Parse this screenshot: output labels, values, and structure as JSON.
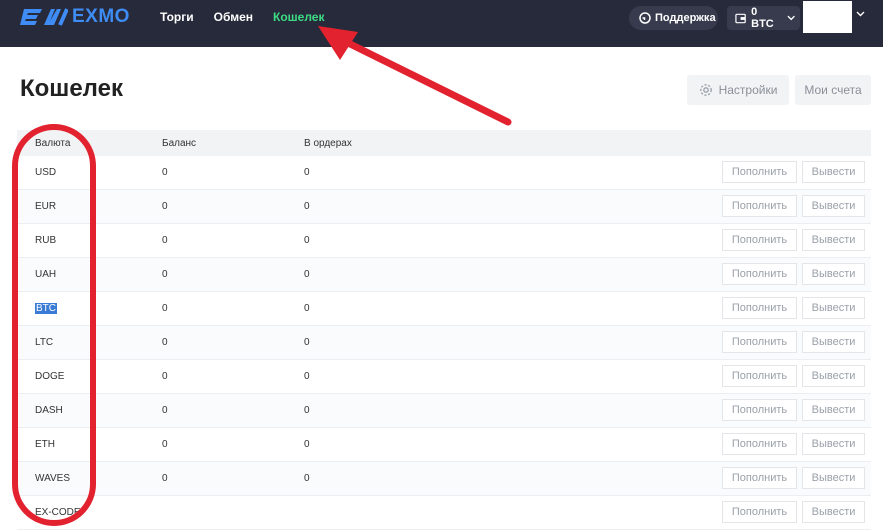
{
  "header": {
    "logo_text": "EXMO",
    "nav": [
      {
        "label": "Торги"
      },
      {
        "label": "Обмен"
      },
      {
        "label": "Кошелек",
        "active": true
      }
    ],
    "support_label": "Поддержка",
    "balance_label": "0 BTC"
  },
  "page": {
    "title": "Кошелек",
    "settings_label": "Настройки",
    "accounts_label": "Мои счета"
  },
  "table": {
    "columns": [
      "Валюта",
      "Баланс",
      "В ордерах"
    ],
    "deposit_label": "Пополнить",
    "withdraw_label": "Вывести",
    "rows": [
      {
        "currency": "USD",
        "balance": "0",
        "in_orders": "0"
      },
      {
        "currency": "EUR",
        "balance": "0",
        "in_orders": "0"
      },
      {
        "currency": "RUB",
        "balance": "0",
        "in_orders": "0"
      },
      {
        "currency": "UAH",
        "balance": "0",
        "in_orders": "0"
      },
      {
        "currency": "BTC",
        "balance": "0",
        "in_orders": "0"
      },
      {
        "currency": "LTC",
        "balance": "0",
        "in_orders": "0"
      },
      {
        "currency": "DOGE",
        "balance": "0",
        "in_orders": "0"
      },
      {
        "currency": "DASH",
        "balance": "0",
        "in_orders": "0"
      },
      {
        "currency": "ETH",
        "balance": "0",
        "in_orders": "0"
      },
      {
        "currency": "WAVES",
        "balance": "0",
        "in_orders": "0"
      },
      {
        "currency": "EX-CODE",
        "balance": "",
        "in_orders": ""
      }
    ]
  },
  "colors": {
    "header_bg": "#262a3a",
    "brand": "#3e8cf4",
    "active_nav": "#3ddc84",
    "annotation": "#e2222e"
  }
}
